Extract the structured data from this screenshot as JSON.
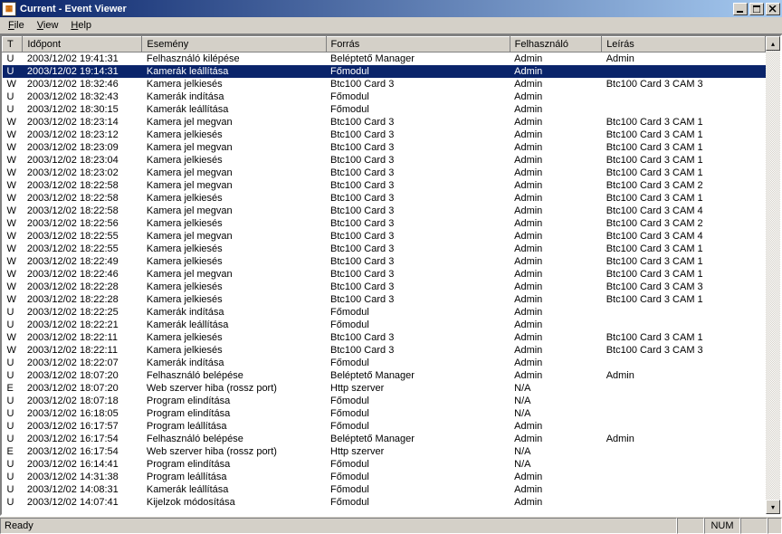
{
  "window": {
    "title": "Current - Event Viewer"
  },
  "menu": {
    "file": "File",
    "view": "View",
    "help": "Help"
  },
  "columns": {
    "t": "T",
    "time": "Időpont",
    "event": "Esemény",
    "source": "Forrás",
    "user": "Felhasználó",
    "desc": "Leírás"
  },
  "col_widths": {
    "t": 22,
    "time": 130,
    "event": 200,
    "source": 200,
    "user": 100,
    "desc": 178
  },
  "selected_index": 1,
  "rows": [
    {
      "t": "U",
      "time": "2003/12/02 19:41:31",
      "event": "Felhasználó kilépése",
      "source": "Beléptető Manager",
      "user": "Admin",
      "desc": "Admin"
    },
    {
      "t": "U",
      "time": "2003/12/02 19:14:31",
      "event": "Kamerák leállítása",
      "source": "Főmodul",
      "user": "Admin",
      "desc": ""
    },
    {
      "t": "W",
      "time": "2003/12/02 18:32:46",
      "event": "Kamera jelkiesés",
      "source": "Btc100 Card 3",
      "user": "Admin",
      "desc": "Btc100 Card 3 CAM 3"
    },
    {
      "t": "U",
      "time": "2003/12/02 18:32:43",
      "event": "Kamerák indítása",
      "source": "Főmodul",
      "user": "Admin",
      "desc": ""
    },
    {
      "t": "U",
      "time": "2003/12/02 18:30:15",
      "event": "Kamerák leállítása",
      "source": "Főmodul",
      "user": "Admin",
      "desc": ""
    },
    {
      "t": "W",
      "time": "2003/12/02 18:23:14",
      "event": "Kamera jel megvan",
      "source": "Btc100 Card 3",
      "user": "Admin",
      "desc": "Btc100 Card 3 CAM 1"
    },
    {
      "t": "W",
      "time": "2003/12/02 18:23:12",
      "event": "Kamera jelkiesés",
      "source": "Btc100 Card 3",
      "user": "Admin",
      "desc": "Btc100 Card 3 CAM 1"
    },
    {
      "t": "W",
      "time": "2003/12/02 18:23:09",
      "event": "Kamera jel megvan",
      "source": "Btc100 Card 3",
      "user": "Admin",
      "desc": "Btc100 Card 3 CAM 1"
    },
    {
      "t": "W",
      "time": "2003/12/02 18:23:04",
      "event": "Kamera jelkiesés",
      "source": "Btc100 Card 3",
      "user": "Admin",
      "desc": "Btc100 Card 3 CAM 1"
    },
    {
      "t": "W",
      "time": "2003/12/02 18:23:02",
      "event": "Kamera jel megvan",
      "source": "Btc100 Card 3",
      "user": "Admin",
      "desc": "Btc100 Card 3 CAM 1"
    },
    {
      "t": "W",
      "time": "2003/12/02 18:22:58",
      "event": "Kamera jel megvan",
      "source": "Btc100 Card 3",
      "user": "Admin",
      "desc": "Btc100 Card 3 CAM 2"
    },
    {
      "t": "W",
      "time": "2003/12/02 18:22:58",
      "event": "Kamera jelkiesés",
      "source": "Btc100 Card 3",
      "user": "Admin",
      "desc": "Btc100 Card 3 CAM 1"
    },
    {
      "t": "W",
      "time": "2003/12/02 18:22:58",
      "event": "Kamera jel megvan",
      "source": "Btc100 Card 3",
      "user": "Admin",
      "desc": "Btc100 Card 3 CAM 4"
    },
    {
      "t": "W",
      "time": "2003/12/02 18:22:56",
      "event": "Kamera jelkiesés",
      "source": "Btc100 Card 3",
      "user": "Admin",
      "desc": "Btc100 Card 3 CAM 2"
    },
    {
      "t": "W",
      "time": "2003/12/02 18:22:55",
      "event": "Kamera jel megvan",
      "source": "Btc100 Card 3",
      "user": "Admin",
      "desc": "Btc100 Card 3 CAM 4"
    },
    {
      "t": "W",
      "time": "2003/12/02 18:22:55",
      "event": "Kamera jelkiesés",
      "source": "Btc100 Card 3",
      "user": "Admin",
      "desc": "Btc100 Card 3 CAM 1"
    },
    {
      "t": "W",
      "time": "2003/12/02 18:22:49",
      "event": "Kamera jelkiesés",
      "source": "Btc100 Card 3",
      "user": "Admin",
      "desc": "Btc100 Card 3 CAM 1"
    },
    {
      "t": "W",
      "time": "2003/12/02 18:22:46",
      "event": "Kamera jel megvan",
      "source": "Btc100 Card 3",
      "user": "Admin",
      "desc": "Btc100 Card 3 CAM 1"
    },
    {
      "t": "W",
      "time": "2003/12/02 18:22:28",
      "event": "Kamera jelkiesés",
      "source": "Btc100 Card 3",
      "user": "Admin",
      "desc": "Btc100 Card 3 CAM 3"
    },
    {
      "t": "W",
      "time": "2003/12/02 18:22:28",
      "event": "Kamera jelkiesés",
      "source": "Btc100 Card 3",
      "user": "Admin",
      "desc": "Btc100 Card 3 CAM 1"
    },
    {
      "t": "U",
      "time": "2003/12/02 18:22:25",
      "event": "Kamerák indítása",
      "source": "Főmodul",
      "user": "Admin",
      "desc": ""
    },
    {
      "t": "U",
      "time": "2003/12/02 18:22:21",
      "event": "Kamerák leállítása",
      "source": "Főmodul",
      "user": "Admin",
      "desc": ""
    },
    {
      "t": "W",
      "time": "2003/12/02 18:22:11",
      "event": "Kamera jelkiesés",
      "source": "Btc100 Card 3",
      "user": "Admin",
      "desc": "Btc100 Card 3 CAM 1"
    },
    {
      "t": "W",
      "time": "2003/12/02 18:22:11",
      "event": "Kamera jelkiesés",
      "source": "Btc100 Card 3",
      "user": "Admin",
      "desc": "Btc100 Card 3 CAM 3"
    },
    {
      "t": "U",
      "time": "2003/12/02 18:22:07",
      "event": "Kamerák indítása",
      "source": "Főmodul",
      "user": "Admin",
      "desc": ""
    },
    {
      "t": "U",
      "time": "2003/12/02 18:07:20",
      "event": "Felhasználó belépése",
      "source": "Beléptető Manager",
      "user": "Admin",
      "desc": "Admin"
    },
    {
      "t": "E",
      "time": "2003/12/02 18:07:20",
      "event": "Web szerver hiba (rossz port)",
      "source": "Http szerver",
      "user": "N/A",
      "desc": ""
    },
    {
      "t": "U",
      "time": "2003/12/02 18:07:18",
      "event": "Program elindítása",
      "source": "Főmodul",
      "user": "N/A",
      "desc": ""
    },
    {
      "t": "U",
      "time": "2003/12/02 16:18:05",
      "event": "Program elindítása",
      "source": "Főmodul",
      "user": "N/A",
      "desc": ""
    },
    {
      "t": "U",
      "time": "2003/12/02 16:17:57",
      "event": "Program leállítása",
      "source": "Főmodul",
      "user": "Admin",
      "desc": ""
    },
    {
      "t": "U",
      "time": "2003/12/02 16:17:54",
      "event": "Felhasználó belépése",
      "source": "Beléptető Manager",
      "user": "Admin",
      "desc": "Admin"
    },
    {
      "t": "E",
      "time": "2003/12/02 16:17:54",
      "event": "Web szerver hiba (rossz port)",
      "source": "Http szerver",
      "user": "N/A",
      "desc": ""
    },
    {
      "t": "U",
      "time": "2003/12/02 16:14:41",
      "event": "Program elindítása",
      "source": "Főmodul",
      "user": "N/A",
      "desc": ""
    },
    {
      "t": "U",
      "time": "2003/12/02 14:31:38",
      "event": "Program leállítása",
      "source": "Főmodul",
      "user": "Admin",
      "desc": ""
    },
    {
      "t": "U",
      "time": "2003/12/02 14:08:31",
      "event": "Kamerák leállítása",
      "source": "Főmodul",
      "user": "Admin",
      "desc": ""
    },
    {
      "t": "U",
      "time": "2003/12/02 14:07:41",
      "event": "Kijelzok módosítása",
      "source": "Főmodul",
      "user": "Admin",
      "desc": ""
    }
  ],
  "status": {
    "ready": "Ready",
    "num": "NUM"
  }
}
